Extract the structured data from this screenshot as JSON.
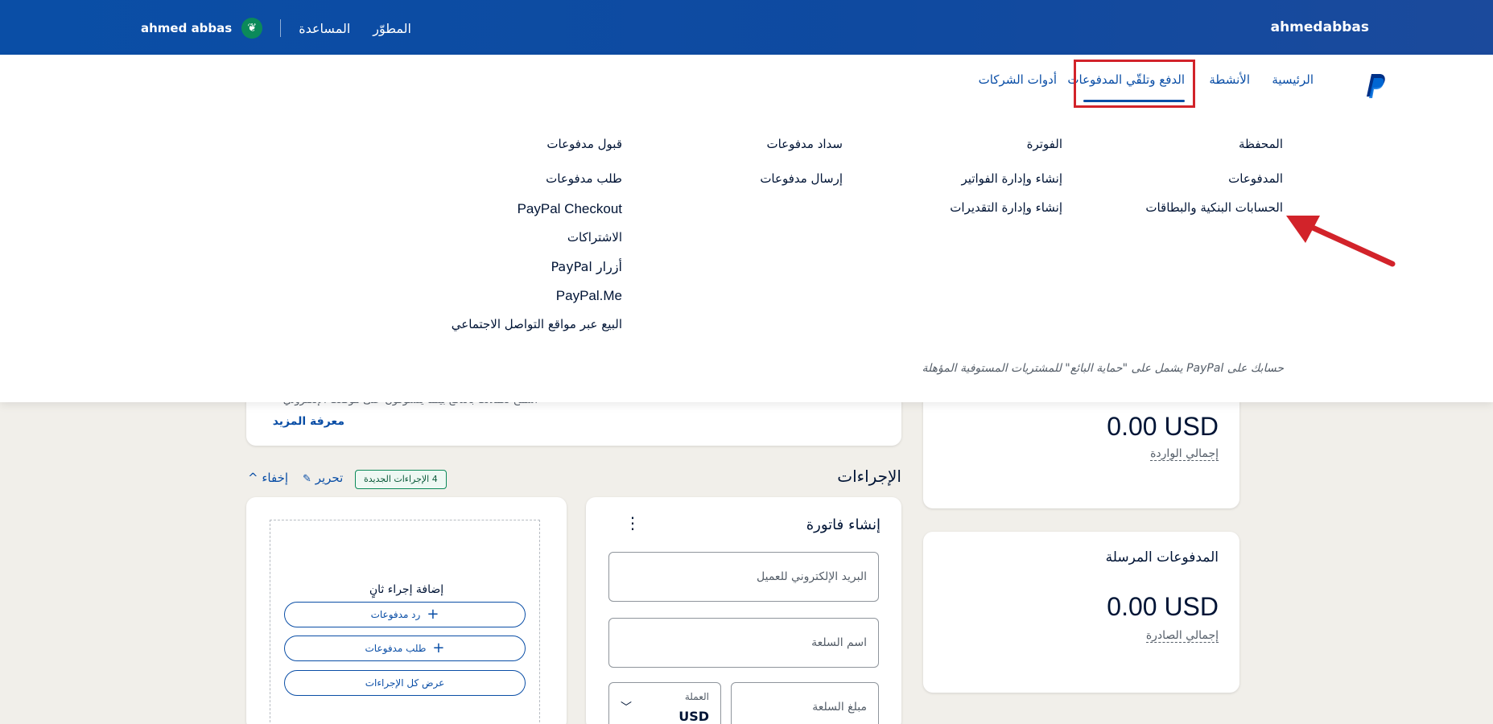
{
  "topbar": {
    "brand_user": "ahmedabbas",
    "user_name": "ahmed abbas",
    "help": "المساعدة",
    "developer": "المطوّر"
  },
  "nav": {
    "home": "الرئيسية",
    "activities": "الأنشطة",
    "pay_receive": "الدفع وتلقّي المدفوعات",
    "business_tools": "أدوات الشركات"
  },
  "menu": {
    "col1": [
      "المحفظة",
      "المدفوعات",
      "الحسابات البنكية والبطاقات"
    ],
    "col2": [
      "الفوترة",
      "إنشاء وإدارة الفواتير",
      "إنشاء وإدارة التقديرات"
    ],
    "col3": [
      "سداد مدفوعات",
      "إرسال مدفوعات"
    ],
    "col4": [
      "قبول مدفوعات",
      "طلب مدفوعات",
      "PayPal Checkout",
      "الاشتراكات",
      "أزرار PayPal",
      "PayPal.Me",
      "البيع عبر مواقع التواصل الاجتماعي"
    ],
    "footnote": "حسابك على PayPal يشمل على \"حماية البائع\" للمشتريات المستوفية المؤهلة"
  },
  "promo": {
    "text": "اسمح لعملائك بالدفع بينما يتسوقون على موقعك الإلكتروني",
    "learn_more": "معرفة المزيد"
  },
  "received": {
    "amount": "0.00 USD",
    "label": "إجمالي الواردة"
  },
  "sent": {
    "title": "المدفوعات المرسلة",
    "amount": "0.00 USD",
    "label": "إجمالي الصادرة"
  },
  "actions": {
    "title": "الإجراءات",
    "badge": "4 الإجراءات الجديدة",
    "edit": "تحرير",
    "hide": "إخفاء"
  },
  "invoice": {
    "title": "إنشاء فاتورة",
    "email_placeholder": "البريد الإلكتروني للعميل",
    "item_name_placeholder": "اسم السلعة",
    "item_amount_placeholder": "مبلغ السلعة",
    "currency_label": "العملة",
    "currency_value": "USD"
  },
  "add_action": {
    "title": "إضافة إجراء ثانٍ",
    "refund": "رد مدفوعات",
    "request": "طلب مدفوعات",
    "view_all": "عرض كل الإجراءات"
  },
  "colors": {
    "brand_blue": "#0a4ea6",
    "highlight_red": "#d2232a",
    "badge_green": "#0b8a5a"
  }
}
